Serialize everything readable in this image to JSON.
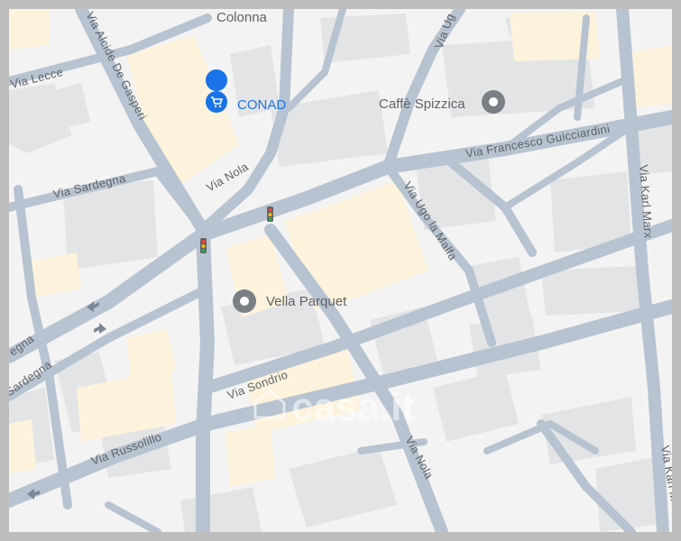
{
  "map": {
    "area_label": "Colonna",
    "streets": {
      "alcide": "Via Alcide De Gasperi",
      "lecce": "Via Lecce",
      "sardegna": "Via Sardegna",
      "sardegna_2": "Sardegna",
      "egna": "egna",
      "nola_top": "Via Nola",
      "nola_bottom": "Via Nola",
      "ugo_top": "Via Ug",
      "ugo_lamalfa": "Via Ugo la Malfa",
      "guicciardini": "Via Francesco Guicciardini",
      "karl_marx": "Via Karl Marx",
      "karl_marx_2": "Via Karl M",
      "sondrio": "Via Sondrio",
      "russolillo": "Via Russolillo"
    },
    "pois": {
      "conad": "CONAD",
      "spizzica": "Caffè Spizzica",
      "vella": "Vella Parquet"
    },
    "watermark": "casa.it",
    "colors": {
      "road": "#b7c3d0",
      "block": "#f3f3f3",
      "building": "#e3e4e6",
      "highlight": "#fdf3dc",
      "poi_blue": "#1a73e8",
      "poi_grey": "#7a7f86"
    },
    "icons": [
      "shopping-cart-icon",
      "place-pin-icon",
      "traffic-light-icon",
      "one-way-arrow-icon"
    ]
  }
}
